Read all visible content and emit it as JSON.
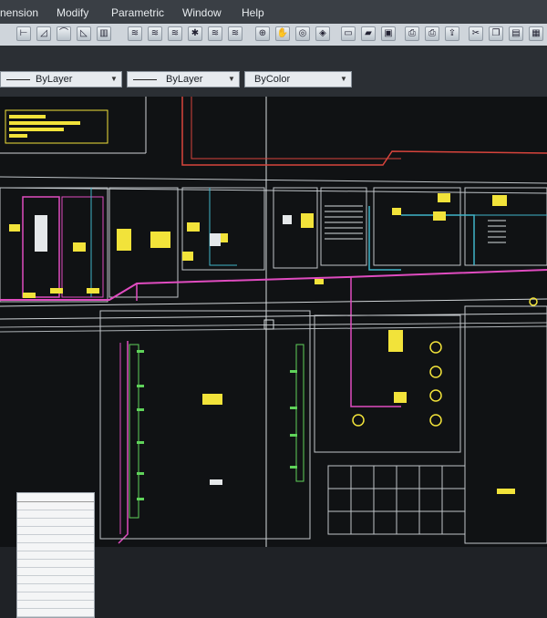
{
  "menu": [
    {
      "label": "nension"
    },
    {
      "label": "Modify"
    },
    {
      "label": "Parametric"
    },
    {
      "label": "Window"
    },
    {
      "label": "Help"
    }
  ],
  "properties": {
    "layer": "ByLayer",
    "linetype": "ByLayer",
    "color": "ByColor"
  },
  "toolbar_icons": [
    "dimension-linear-icon",
    "dimension-angular-icon",
    "dimension-arc-icon",
    "dimension-ordinate-icon",
    "dimension-table-icon",
    "layer-manager-icon",
    "layer-state-icon",
    "layer-isolate-icon",
    "layer-freeze-icon",
    "layer-lock-icon",
    "layer-match-icon",
    "zoom-icon",
    "pan-icon",
    "orbit-icon",
    "view-icon",
    "open-icon",
    "save-folder-icon",
    "save-icon",
    "print-icon",
    "print-preview-icon",
    "publish-icon",
    "cut-icon",
    "copy-icon",
    "paste-icon",
    "match-properties-icon"
  ],
  "colors": {
    "yellow": "#f2e33a",
    "magenta": "#e04cc0",
    "red": "#d8443c",
    "cyan": "#3fb4c9",
    "green": "#5fd35a",
    "white": "#d9dde0"
  }
}
